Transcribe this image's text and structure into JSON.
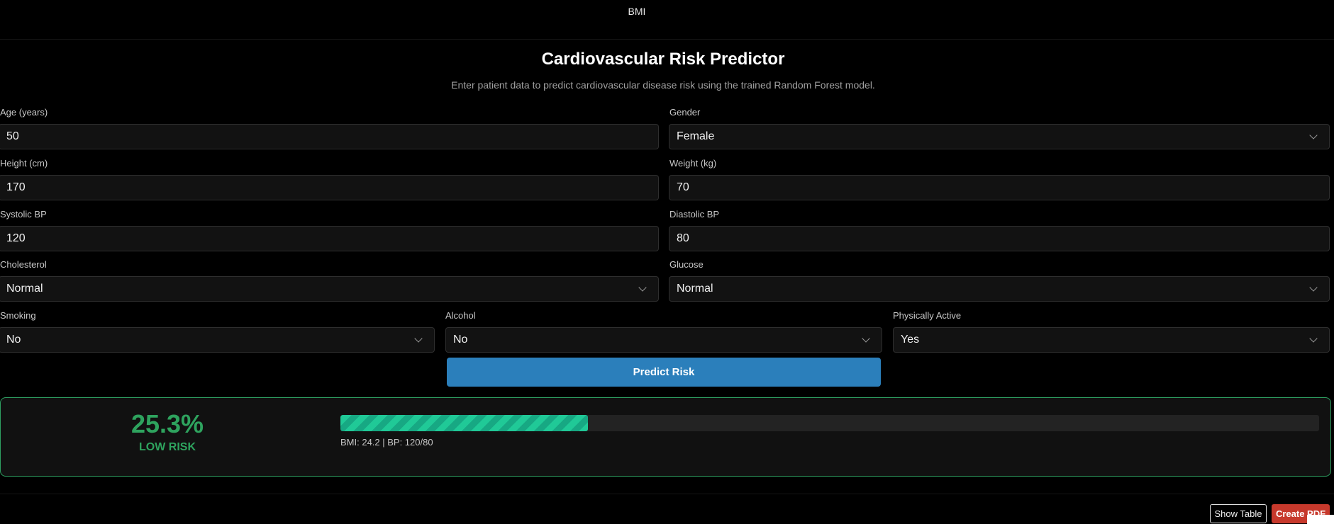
{
  "header": {
    "tab_bmi": "BMI"
  },
  "page": {
    "title": "Cardiovascular Risk Predictor",
    "subtitle": "Enter patient data to predict cardiovascular disease risk using the trained Random Forest model."
  },
  "form": {
    "age": {
      "label": "Age (years)",
      "value": "50"
    },
    "gender": {
      "label": "Gender",
      "value": "Female"
    },
    "height": {
      "label": "Height (cm)",
      "value": "170"
    },
    "weight": {
      "label": "Weight (kg)",
      "value": "70"
    },
    "systolic": {
      "label": "Systolic BP",
      "value": "120"
    },
    "diastolic": {
      "label": "Diastolic BP",
      "value": "80"
    },
    "cholesterol": {
      "label": "Cholesterol",
      "value": "Normal"
    },
    "glucose": {
      "label": "Glucose",
      "value": "Normal"
    },
    "smoking": {
      "label": "Smoking",
      "value": "No"
    },
    "alcohol": {
      "label": "Alcohol",
      "value": "No"
    },
    "active": {
      "label": "Physically Active",
      "value": "Yes"
    },
    "predict_label": "Predict Risk"
  },
  "result": {
    "risk_percent": "25.3%",
    "risk_level": "LOW RISK",
    "progress_fraction": 0.253,
    "info": "BMI: 24.2 | BP: 120/80",
    "accent_color": "#2ea35e",
    "bar_color": "#20c997"
  },
  "footer": {
    "show_table_label": "Show Table",
    "create_pdf_label": "Create PDF"
  }
}
